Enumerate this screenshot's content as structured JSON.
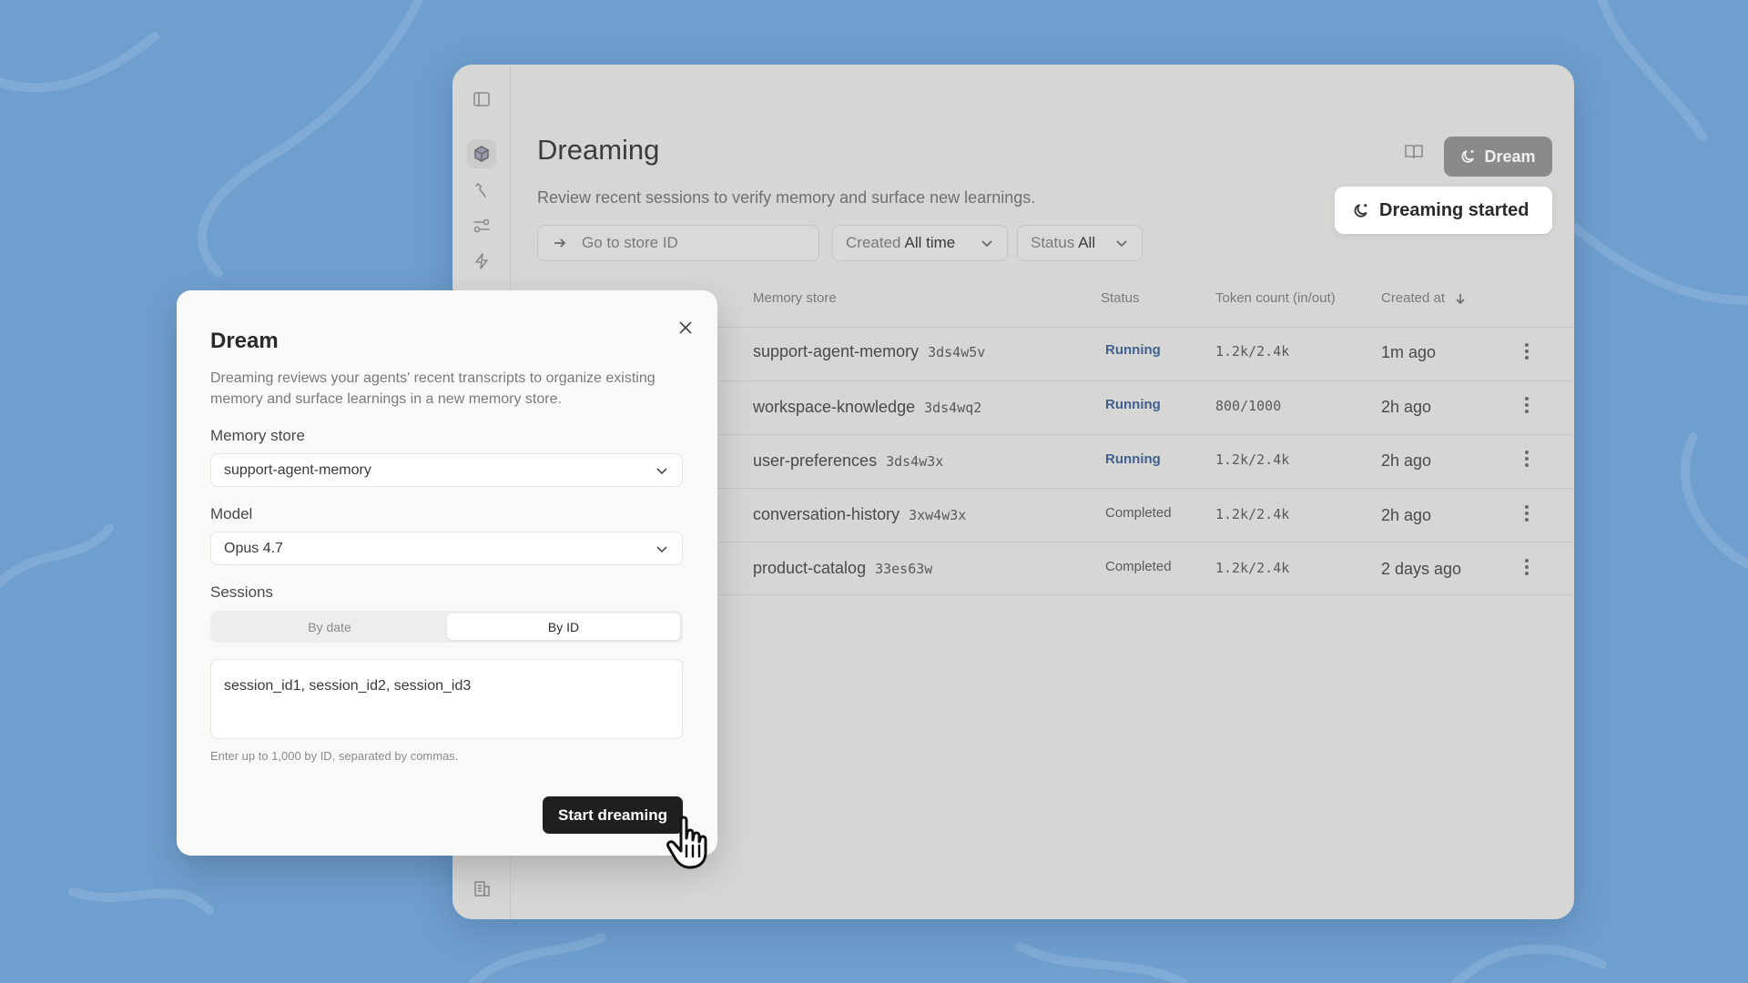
{
  "colors": {
    "background": "#6f9fcf",
    "window": "#d6d6d4",
    "modal": "#f9f9f7",
    "primary_button": "#1f1f1d",
    "running_status": "#41608f"
  },
  "sidebar": {
    "icons": [
      "panel-toggle-icon",
      "cube-icon",
      "tool-icon",
      "flow-icon",
      "bolt-icon",
      "building-icon"
    ]
  },
  "page": {
    "title": "Dreaming",
    "subtitle": "Review recent sessions to verify memory and surface new learnings.",
    "dream_button": "Dream",
    "toast": "Dreaming started"
  },
  "filters": {
    "store_placeholder": "Go to store ID",
    "created_label": "Created",
    "created_value": "All time",
    "status_label": "Status",
    "status_value": "All"
  },
  "table": {
    "headers": {
      "memory_store": "Memory store",
      "status": "Status",
      "tokens": "Token count (in/out)",
      "created": "Created at"
    },
    "rows": [
      {
        "name": "support-agent-memory",
        "id": "3ds4w5v",
        "status": "Running",
        "tokens": "1.2k/2.4k",
        "created": "1m ago"
      },
      {
        "name": "workspace-knowledge",
        "id": "3ds4wq2",
        "status": "Running",
        "tokens": "800/1000",
        "created": "2h ago"
      },
      {
        "name": "user-preferences",
        "id": "3ds4w3x",
        "status": "Running",
        "tokens": "1.2k/2.4k",
        "created": "2h ago"
      },
      {
        "name": "conversation-history",
        "id": "3xw4w3x",
        "status": "Completed",
        "tokens": "1.2k/2.4k",
        "created": "2h ago"
      },
      {
        "name": "product-catalog",
        "id": "33es63w",
        "status": "Completed",
        "tokens": "1.2k/2.4k",
        "created": "2 days ago"
      }
    ]
  },
  "modal": {
    "title": "Dream",
    "description": "Dreaming reviews your agents' recent transcripts to organize existing memory and surface learnings in a new memory store.",
    "memory_store_label": "Memory store",
    "memory_store_value": "support-agent-memory",
    "model_label": "Model",
    "model_value": "Opus 4.7",
    "sessions_label": "Sessions",
    "tab_by_date": "By date",
    "tab_by_id": "By ID",
    "sessions_value": "session_id1, session_id2, session_id3",
    "hint": "Enter up to 1,000 by ID, separated by commas.",
    "start_button": "Start dreaming"
  }
}
